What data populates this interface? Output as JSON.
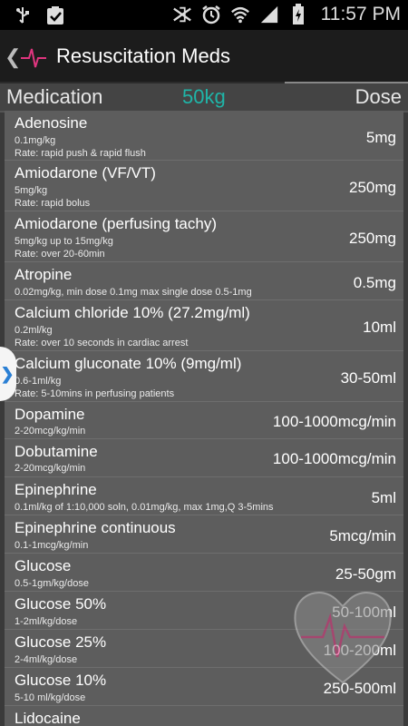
{
  "status_bar": {
    "time": "11:57 PM",
    "icons_left": [
      "usb-icon",
      "clipboard-check-icon"
    ],
    "icons_right": [
      "bluetooth-mute-icon",
      "alarm-icon",
      "wifi-icon",
      "signal-icon",
      "battery-charging-icon"
    ]
  },
  "app_bar": {
    "title": "Resuscitation Meds"
  },
  "columns": {
    "medication": "Medication",
    "weight": "50kg",
    "dose": "Dose"
  },
  "meds": [
    {
      "name": "Adenosine",
      "note1": "0.1mg/kg",
      "note2": "Rate: rapid push & rapid flush",
      "dose": "5mg"
    },
    {
      "name": "Amiodarone (VF/VT)",
      "note1": "5mg/kg",
      "note2": "Rate: rapid bolus",
      "dose": "250mg"
    },
    {
      "name": "Amiodarone (perfusing tachy)",
      "note1": "5mg/kg up to 15mg/kg",
      "note2": "Rate: over 20-60min",
      "dose": "250mg"
    },
    {
      "name": "Atropine",
      "note1": "0.02mg/kg, min dose 0.1mg max single dose 0.5-1mg",
      "note2": "",
      "dose": "0.5mg"
    },
    {
      "name": "Calcium chloride 10% (27.2mg/ml)",
      "note1": "0.2ml/kg",
      "note2": "Rate: over 10 seconds in cardiac arrest",
      "dose": "10ml"
    },
    {
      "name": "Calcium gluconate 10% (9mg/ml)",
      "note1": "0.6-1ml/kg",
      "note2": "Rate: 5-10mins in perfusing patients",
      "dose": "30-50ml"
    },
    {
      "name": "Dopamine",
      "note1": "2-20mcg/kg/min",
      "note2": "",
      "dose": "100-1000mcg/min"
    },
    {
      "name": "Dobutamine",
      "note1": "2-20mcg/kg/min",
      "note2": "",
      "dose": "100-1000mcg/min"
    },
    {
      "name": "Epinephrine",
      "note1": "0.1ml/kg of 1:10,000 soln, 0.01mg/kg, max 1mg,Q 3-5mins",
      "note2": "",
      "dose": "5ml"
    },
    {
      "name": "Epinephrine continuous",
      "note1": "0.1-1mcg/kg/min",
      "note2": "",
      "dose": "5mcg/min"
    },
    {
      "name": "Glucose",
      "note1": "0.5-1gm/kg/dose",
      "note2": "",
      "dose": "25-50gm"
    },
    {
      "name": "Glucose 50%",
      "note1": "1-2ml/kg/dose",
      "note2": "",
      "dose": "50-100ml"
    },
    {
      "name": "Glucose 25%",
      "note1": "2-4ml/kg/dose",
      "note2": "",
      "dose": "100-200ml"
    },
    {
      "name": "Glucose 10%",
      "note1": "5-10 ml/kg/dose",
      "note2": "",
      "dose": "250-500ml"
    },
    {
      "name": "Lidocaine",
      "note1": "",
      "note2": "",
      "dose": ""
    }
  ],
  "colors": {
    "weight_accent": "#1fb5a8",
    "logo_pink": "#e0357f",
    "edge_tab_arrow": "#2a7fd4"
  }
}
